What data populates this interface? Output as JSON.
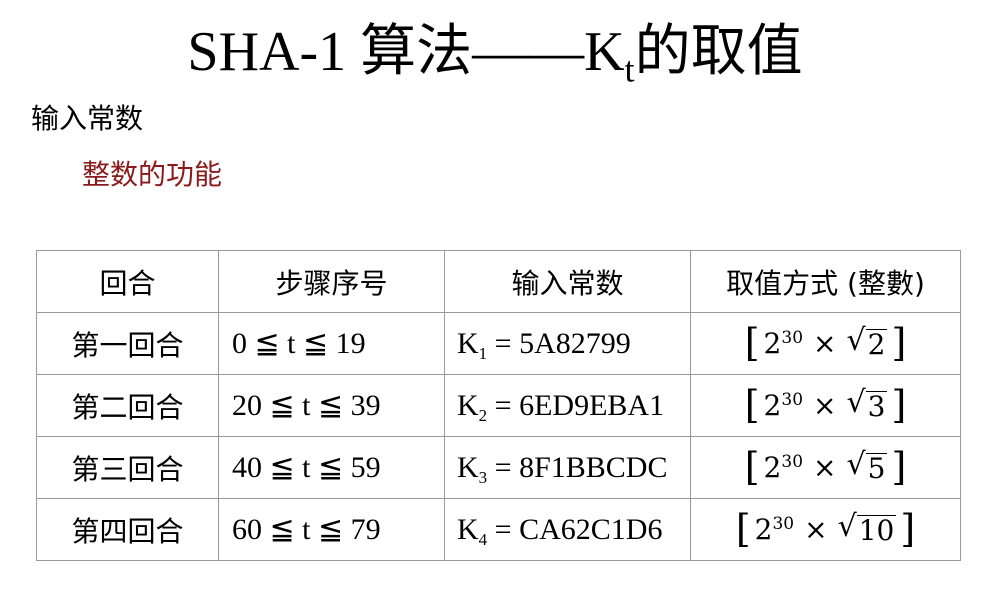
{
  "title": {
    "main": "SHA-1 算法——K",
    "subscript": "t",
    "suffix": "的取值"
  },
  "subtitle": "输入常数",
  "subtitle2": "整数的功能",
  "table": {
    "headers": [
      "回合",
      "步骤序号",
      "输入常数",
      "取值方式 (整數)"
    ],
    "rows": [
      {
        "round": "第一回合",
        "range": "0 ≦ t ≦ 19",
        "const_k": "K",
        "const_sub": "1",
        "const_val": " = 5A82799",
        "base": "2",
        "exp": "30",
        "times": "×",
        "radicand": "2"
      },
      {
        "round": "第二回合",
        "range": "20 ≦ t ≦ 39",
        "const_k": "K",
        "const_sub": "2",
        "const_val": " = 6ED9EBA1",
        "base": "2",
        "exp": "30",
        "times": "×",
        "radicand": "3"
      },
      {
        "round": "第三回合",
        "range": "40 ≦ t ≦ 59",
        "const_k": "K",
        "const_sub": "3",
        "const_val": " = 8F1BBCDC",
        "base": "2",
        "exp": "30",
        "times": "×",
        "radicand": "5"
      },
      {
        "round": "第四回合",
        "range": "60 ≦ t ≦ 79",
        "const_k": "K",
        "const_sub": "4",
        "const_val": " = CA62C1D6",
        "base": "2",
        "exp": "30",
        "times": "×",
        "radicand": "10"
      }
    ]
  }
}
